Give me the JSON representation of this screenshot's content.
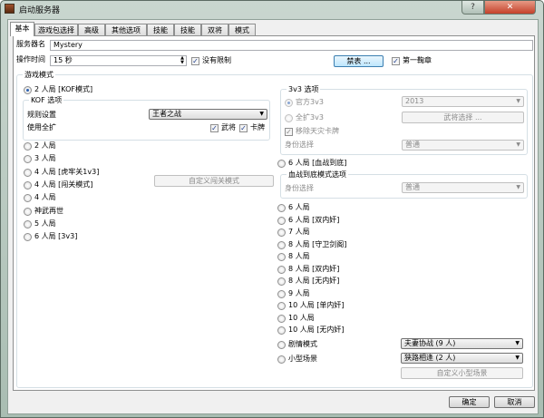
{
  "window": {
    "title": "启动服务器",
    "help": "?",
    "close": "✕"
  },
  "tabs": [
    "基本",
    "游戏包选择",
    "高级",
    "其他选项",
    "技能",
    "技能",
    "双将",
    "模式"
  ],
  "server_name": {
    "label": "服务器名",
    "value": "Mystery"
  },
  "op_time": {
    "label": "操作时间",
    "value": "15 秒",
    "no_limit": "没有限制",
    "no_limit_checked": true
  },
  "ban_button": "禁表 ...",
  "first_round": {
    "label": "第一鞠章",
    "checked": true
  },
  "game_mode": {
    "title": "游戏模式",
    "kof": {
      "label": "2 人局 [KOF模式]",
      "checked": true,
      "group": "KOF 选项",
      "rule_label": "规则设置",
      "rule_value": "王者之战",
      "expand_label": "使用全扩",
      "generals": "武将",
      "cards": "卡牌"
    },
    "left_modes": [
      "2 人局",
      "3 人局",
      "4 人局 [虎牢关1v3]",
      "4 人局 [闯关模式]",
      "4 人局",
      "神武再世",
      "5 人局",
      "6 人局 [3v3]"
    ],
    "custom_pass": "自定义闯关模式",
    "v3": {
      "group": "3v3 选项",
      "official": "官方3v3",
      "official_value": "2013",
      "full": "全扩3v3",
      "general_select": "武将选择 ...",
      "remove_card": "移除天灾卡牌",
      "role_label": "身份选择",
      "role_value": "普通"
    },
    "blood": {
      "label": "6 人局 [血战到底]",
      "group": "血战到底模式选项",
      "role_label": "身份选择",
      "role_value": "普通"
    },
    "right_modes": [
      "6 人局",
      "6 人局 [双内奸]",
      "7 人局",
      "8 人局 [守卫剑阁]",
      "8 人局",
      "8 人局 [双内奸]",
      "8 人局 [无内奸]",
      "9 人局",
      "10 人局 [单内奸]",
      "10 人局",
      "10 人局 [无内奸]"
    ],
    "story": {
      "label": "剧情模式",
      "value": "夫妻协战 (9 人)"
    },
    "mini": {
      "label": "小型场景",
      "value": "狭路相逢 (2 人)",
      "custom": "自定义小型场景"
    }
  },
  "footer": {
    "ok": "确定",
    "cancel": "取消"
  }
}
